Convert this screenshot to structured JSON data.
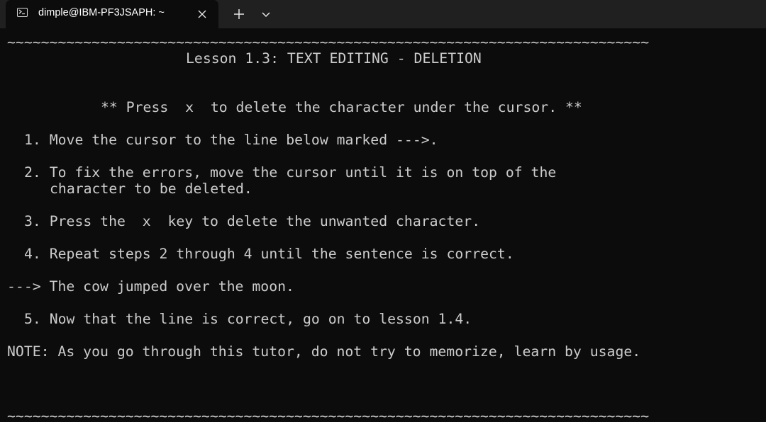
{
  "window": {
    "tab_title": "dimple@IBM-PF3JSAPH: ~",
    "tab_icon": "terminal-icon",
    "close_icon": "close-icon",
    "new_tab_icon": "plus-icon",
    "dropdown_icon": "chevron-down-icon"
  },
  "colors": {
    "background": "#0c0c0c",
    "titlebar": "#202020",
    "text": "#cccccc"
  },
  "terminal": {
    "border_top": "~~~~~~~~~~~~~~~~~~~~~~~~~~~~~~~~~~~~~~~~~~~~~~~~~~~~~~~~~~~~~~~~~~~~~~~~~~~~",
    "lesson_title": "Lesson 1.3: TEXT EDITING - DELETION",
    "instruction": "** Press  x  to delete the character under the cursor. **",
    "step1": "1. Move the cursor to the line below marked --->.",
    "step2_line1": "2. To fix the errors, move the cursor until it is on top of the",
    "step2_line2": "character to be deleted.",
    "step3": "3. Press the  x  key to delete the unwanted character.",
    "step4": "4. Repeat steps 2 through 4 until the sentence is correct.",
    "practice_line": "---> The cow jumped over the moon.",
    "step5": "5. Now that the line is correct, go on to lesson 1.4.",
    "note": "NOTE: As you go through this tutor, do not try to memorize, learn by usage.",
    "border_bottom": "~~~~~~~~~~~~~~~~~~~~~~~~~~~~~~~~~~~~~~~~~~~~~~~~~~~~~~~~~~~~~~~~~~~~~~~~~~~~"
  }
}
